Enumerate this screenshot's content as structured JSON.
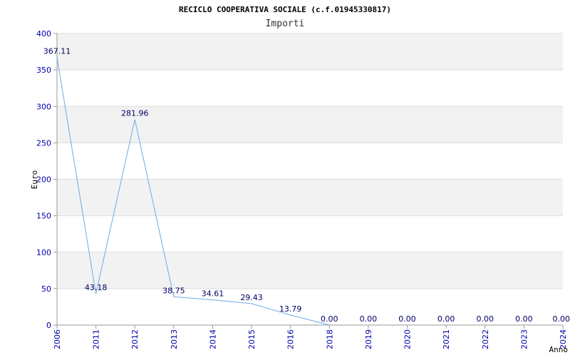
{
  "chart_data": {
    "type": "line",
    "title": "RECICLO COOPERATIVA SOCIALE (c.f.01945330817)",
    "subtitle": "Importi",
    "xlabel": "Anno",
    "ylabel": "Euro",
    "categories": [
      "2006",
      "2011",
      "2012",
      "2013",
      "2014",
      "2015",
      "2016",
      "2018",
      "2019",
      "2020",
      "2021",
      "2022",
      "2023",
      "2024"
    ],
    "series": [
      {
        "values": [
          367.11,
          43.18,
          281.96,
          38.75,
          34.61,
          29.43,
          13.79,
          0.0,
          null,
          null,
          null,
          null,
          null,
          null
        ],
        "labels": [
          "367.11",
          "43.18",
          "281.96",
          "38.75",
          "34.61",
          "29.43",
          "13.79",
          "0.00",
          "0.00",
          "0.00",
          "0.00",
          "0.00",
          "0.00",
          "0.00"
        ]
      }
    ],
    "ylim": [
      0,
      400
    ],
    "yticks": [
      0,
      50,
      100,
      150,
      200,
      250,
      300,
      350,
      400
    ],
    "grid": true,
    "colors": {
      "line": "#6aaae8",
      "band": "#f2f2f2",
      "ticks": "#0000aa",
      "labels": "#000066",
      "axis": "#999999"
    }
  }
}
